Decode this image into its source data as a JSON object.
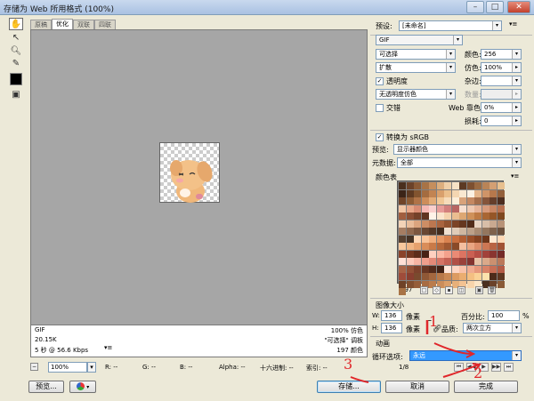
{
  "window": {
    "title": "存储为 Web 所用格式 (100%)",
    "min": "–",
    "max": "□",
    "close": "✕"
  },
  "tabs": [
    "原稿",
    "优化",
    "双联",
    "四联"
  ],
  "tools": [
    "hand-icon",
    "slice-select-icon",
    "zoom-icon",
    "eyedropper-icon",
    "color-swatch",
    "toggle-slices-icon"
  ],
  "info": {
    "left": [
      "GIF",
      "20.15K",
      "5 秒 @ 56.6 Kbps"
    ],
    "right": [
      "100% 仿色",
      "\"可选择\" 调板",
      "197 颜色"
    ],
    "menu_icon": "▾≡"
  },
  "status": {
    "zoom": "100%",
    "r": "R: --",
    "g": "G: --",
    "b": "B: --",
    "alpha": "Alpha: --",
    "hex": "十六进制: --",
    "index": "索引: --"
  },
  "preset": {
    "label": "预设:",
    "value": "[未命名]"
  },
  "format": "GIF",
  "reduction": "可选择",
  "dither_algo": "扩散",
  "transparency": {
    "label": "透明度",
    "checked": true
  },
  "trans_dither": "无透明度仿色",
  "interlace": {
    "label": "交错",
    "checked": false
  },
  "colors": {
    "label": "颜色:",
    "value": "256"
  },
  "dither": {
    "label": "仿色:",
    "value": "100%"
  },
  "matte": {
    "label": "杂边:",
    "value": ""
  },
  "amount": {
    "label": "数量:",
    "value": ""
  },
  "websnap": {
    "label": "Web 靠色:",
    "value": "0%"
  },
  "lossy": {
    "label": "损耗:",
    "value": "0"
  },
  "srgb": {
    "label": "转换为 sRGB",
    "checked": true
  },
  "preview": {
    "label": "预览:",
    "value": "显示器颜色"
  },
  "metadata": {
    "label": "元数据:",
    "value": "全部"
  },
  "color_table": {
    "label": "颜色表",
    "count": "197"
  },
  "image_size": {
    "label": "图像大小",
    "w_label": "W:",
    "w": "136",
    "w_unit": "像素",
    "h_label": "H:",
    "h": "136",
    "h_unit": "像素",
    "percent_label": "百分比:",
    "percent": "100",
    "percent_unit": "%",
    "quality_label": "品质:",
    "quality": "两次立方"
  },
  "animation": {
    "label": "动画",
    "loop_label": "循环选项:",
    "loop": "永远",
    "frame": "1/8",
    "controls": [
      "⏮",
      "◀◀",
      "▶",
      "▶▶",
      "⏭"
    ]
  },
  "buttons": {
    "preview": "预览...",
    "save": "存储...",
    "cancel": "取消",
    "done": "完成"
  },
  "annotations": [
    "1",
    "2",
    "3"
  ],
  "palette_colors": [
    "#4a2f1e",
    "#6b4229",
    "#8a5a36",
    "#a87346",
    "#c58e5d",
    "#dcae7e",
    "#efcfa8",
    "#f7e2c6",
    "#5c3a24",
    "#7d5031",
    "#9a6a42",
    "#b98457",
    "#d39f73",
    "#e8c08f",
    "#3b2417",
    "#5e3a22",
    "#82542f",
    "#a46c40",
    "#c28452",
    "#d9a06c",
    "#ebbf8c",
    "#f4d6b1",
    "#f9e8d1",
    "#fbf1e4",
    "#e4b48a",
    "#cf9468",
    "#b7784c",
    "#93603b",
    "#704428",
    "#8e5c35",
    "#b07347",
    "#cd8d5a",
    "#e2ab76",
    "#f0c796",
    "#f6dcbb",
    "#fceed9",
    "#d8a27a",
    "#c48862",
    "#a46d4b",
    "#85543a",
    "#653e2b",
    "#4d2e20",
    "#f2c6a5",
    "#e8a88a",
    "#d98c73",
    "#f5b8b3",
    "#f9cfcc",
    "#e79c98",
    "#d37f7c",
    "#b86562",
    "#f7dfd0",
    "#efc9b2",
    "#e5b297",
    "#d89b7c",
    "#c98663",
    "#b87150",
    "#a15e3f",
    "#8a4e34",
    "#744129",
    "#5f3420",
    "#fff4e8",
    "#fbe5cc",
    "#f4d2ad",
    "#eabd90",
    "#dda773",
    "#cf915a",
    "#bd7a44",
    "#a96633",
    "#955627",
    "#7f481f",
    "#f3d3b7",
    "#e8bc9a",
    "#dba47e",
    "#cd8d65",
    "#bc7750",
    "#a9643f",
    "#925331",
    "#7b4427",
    "#66371f",
    "#522c19",
    "#e6d2c0",
    "#d8bea8",
    "#c9a990",
    "#b89378",
    "#a57d62",
    "#91694f",
    "#7c563f",
    "#684632",
    "#553827",
    "#432c1e",
    "#f0e0d0",
    "#e0ccb8",
    "#cfb7a0",
    "#bda189",
    "#a98b72",
    "#94765e",
    "#7f624c",
    "#6b503d",
    "#584130",
    "#463325",
    "#fdd7b6",
    "#f8c399",
    "#f0ae7e",
    "#e69866",
    "#d98350",
    "#c86f3f",
    "#b25e33",
    "#9a4f29",
    "#834221",
    "#6d361b",
    "#ffe7cf",
    "#fdd9b7",
    "#f8c89d",
    "#f0b584",
    "#e6a16d",
    "#d98d59",
    "#c97a48",
    "#b5683b",
    "#9f5831",
    "#894a28",
    "#f4bfa0",
    "#eaa683",
    "#dd8e6a",
    "#cd7754",
    "#b86343",
    "#a15235",
    "#8a432b",
    "#733722",
    "#5d2c1b",
    "#482215",
    "#ffd0c0",
    "#fbb9a5",
    "#f4a18c",
    "#ea8a75",
    "#dc7462",
    "#cb6052",
    "#b74f45",
    "#a1413a",
    "#8a3530",
    "#742b27",
    "#ffe0d6",
    "#fccbbc",
    "#f6b5a4",
    "#ee9f8d",
    "#e38978",
    "#d57465",
    "#c46154",
    "#b05046",
    "#9a413a",
    "#843430",
    "#e7c2a6",
    "#daa98a",
    "#cb9070",
    "#bb7859",
    "#a86346",
    "#935137",
    "#7d422c",
    "#683623",
    "#542b1c",
    "#422216",
    "#ffe6d9",
    "#fdd5c2",
    "#f8c1a9",
    "#f0ac91",
    "#e5977b",
    "#d88267",
    "#c76e55",
    "#b45c46",
    "#9f4c3a",
    "#893f30",
    "#7a4a2e",
    "#8f5836",
    "#a4673f",
    "#b87849",
    "#cb8954",
    "#dc9b61",
    "#eaad70",
    "#f4bf82",
    "#fad196",
    "#fde2ad",
    "#4c2b1a",
    "#5d3620",
    "#6f4227",
    "#824f2f",
    "#955d38",
    "#a86c42",
    "#ba7c4d",
    "#cb8d5a",
    "#da9e68",
    "#e7b07a",
    "#f3c292",
    "#f8d4ab",
    "#fce5c6"
  ]
}
